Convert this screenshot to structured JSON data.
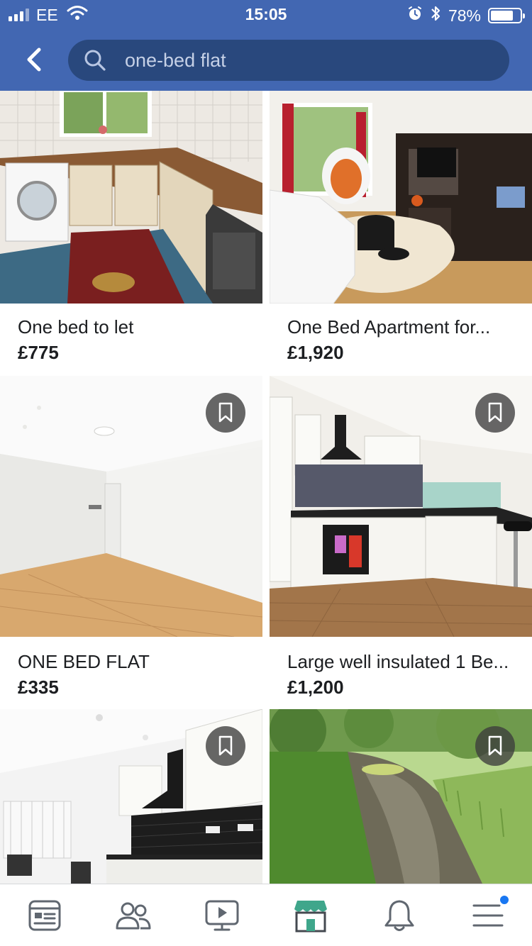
{
  "status_bar": {
    "carrier": "EE",
    "time": "15:05",
    "battery": "78%",
    "battery_level": 0.78,
    "icons": [
      "signal-icon",
      "wifi-icon",
      "alarm-icon",
      "bluetooth-icon",
      "battery-icon"
    ]
  },
  "header": {
    "back_icon": "chevron-left-icon",
    "search": {
      "value": "one-bed flat",
      "icon": "search-icon"
    }
  },
  "listings": [
    {
      "title": "One bed to let",
      "price": "£775",
      "image": "kitchen-with-washing-machine"
    },
    {
      "title": "One Bed Apartment for...",
      "price": "£1,920",
      "image": "living-room-egg-chair"
    },
    {
      "title": "ONE BED FLAT",
      "price": "£335",
      "image": "empty-room-wood-floor"
    },
    {
      "title": "Large well insulated 1 Be...",
      "price": "£1,200",
      "image": "white-kitchen-wood-floor"
    },
    {
      "title": "",
      "price": "",
      "image": "kitchen-black-tiles"
    },
    {
      "title": "",
      "price": "",
      "image": "river-greenery"
    }
  ],
  "tabbar": {
    "tabs": [
      {
        "name": "news-feed",
        "icon": "news-feed-icon",
        "active": false
      },
      {
        "name": "friends",
        "icon": "friends-icon",
        "active": false
      },
      {
        "name": "watch",
        "icon": "video-icon",
        "active": false
      },
      {
        "name": "marketplace",
        "icon": "marketplace-shop-icon",
        "active": true
      },
      {
        "name": "notifications",
        "icon": "bell-icon",
        "active": false
      },
      {
        "name": "menu",
        "icon": "menu-icon",
        "active": false,
        "badge": true
      }
    ]
  },
  "colors": {
    "brand": "#4267b2",
    "search_bg": "#29487d",
    "marketplace_green": "#3fa68b",
    "badge_blue": "#1877f2"
  }
}
